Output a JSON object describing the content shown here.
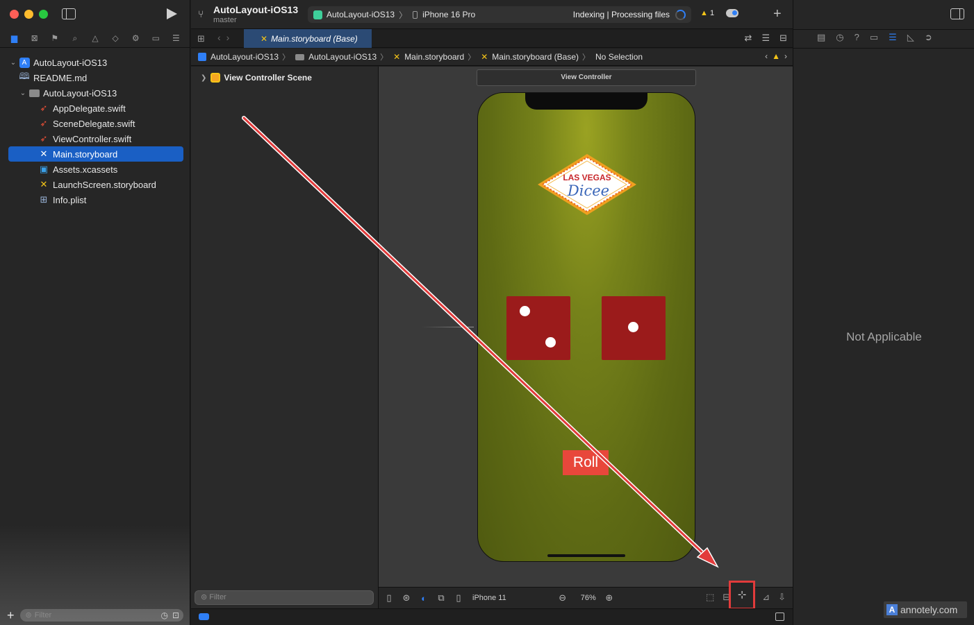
{
  "toolbar": {
    "project_title": "AutoLayout-iOS13",
    "branch": "master",
    "scheme": "AutoLayout-iOS13",
    "device": "iPhone 16 Pro",
    "status": "Indexing | Processing files",
    "warnings": "1",
    "icons": [
      "sidebar-toggle-icon",
      "run-icon",
      "branch-icon",
      "cloud-icon",
      "plus-icon"
    ]
  },
  "navigator": {
    "tabs": [
      "folder-icon",
      "source-control-icon",
      "bookmark-icon",
      "find-icon",
      "issue-icon",
      "test-icon",
      "debug-icon",
      "breakpoint-icon",
      "report-icon"
    ],
    "items": [
      {
        "label": "AutoLayout-iOS13",
        "type": "project"
      },
      {
        "label": "README.md",
        "type": "book"
      },
      {
        "label": "AutoLayout-iOS13",
        "type": "folder"
      },
      {
        "label": "AppDelegate.swift",
        "type": "swift"
      },
      {
        "label": "SceneDelegate.swift",
        "type": "swift"
      },
      {
        "label": "ViewController.swift",
        "type": "swift"
      },
      {
        "label": "Main.storyboard",
        "type": "storyboard"
      },
      {
        "label": "Assets.xcassets",
        "type": "assets"
      },
      {
        "label": "LaunchScreen.storyboard",
        "type": "storyboard"
      },
      {
        "label": "Info.plist",
        "type": "plist"
      }
    ],
    "filter_placeholder": "Filter"
  },
  "editor": {
    "active_tab": "Main.storyboard (Base)",
    "jumpbar": [
      "AutoLayout-iOS13",
      "AutoLayout-iOS13",
      "Main.storyboard",
      "Main.storyboard (Base)",
      "No Selection"
    ]
  },
  "outline": {
    "scene": "View Controller Scene",
    "filter_placeholder": "Filter"
  },
  "canvas": {
    "vc_label": "View Controller",
    "logo_line1": "LAS VEGAS",
    "logo_line2": "Dicee",
    "roll_label": "Roll",
    "device": "iPhone 11",
    "zoom": "76%",
    "colors": {
      "felt": "#76821a",
      "die": "#9b1b1b",
      "button": "#e8473b",
      "highlight": "#e23b3b"
    }
  },
  "inspector": {
    "tabs": [
      "file-icon",
      "history-icon",
      "help-icon",
      "identity-icon",
      "attributes-icon",
      "size-icon",
      "connections-icon"
    ],
    "message": "Not Applicable"
  },
  "watermark": "annotely.com"
}
